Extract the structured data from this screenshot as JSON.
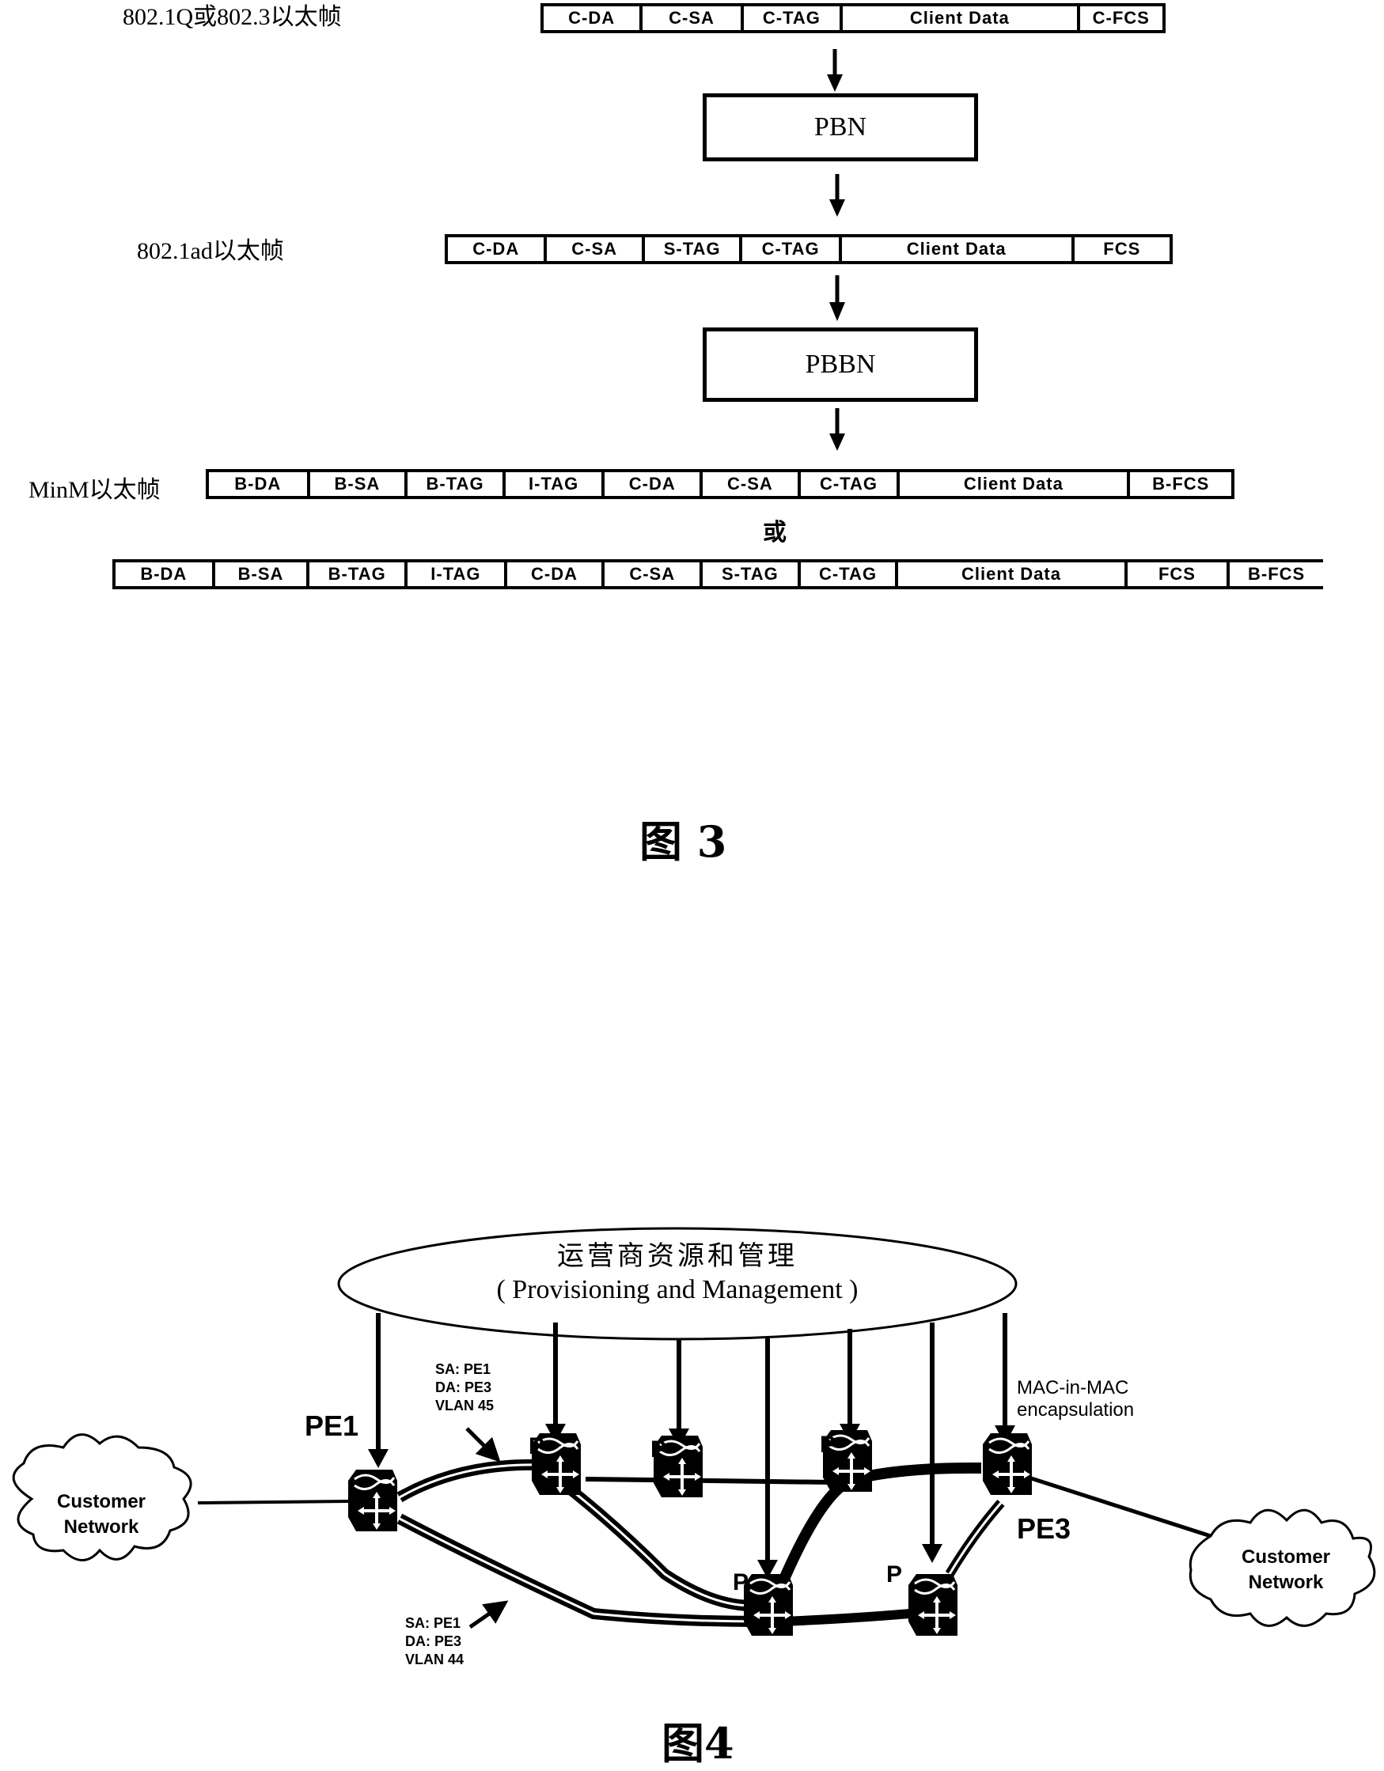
{
  "figure3": {
    "caption": "图 3",
    "frames": [
      {
        "label": "802.1Q或802.3以太帧",
        "fields": [
          "C-DA",
          "C-SA",
          "C-TAG",
          "Client Data",
          "C-FCS"
        ]
      },
      {
        "label": "802.1ad以太帧",
        "fields": [
          "C-DA",
          "C-SA",
          "S-TAG",
          "C-TAG",
          "Client Data",
          "FCS"
        ]
      },
      {
        "label": "MinM以太帧",
        "fields": [
          "B-DA",
          "B-SA",
          "B-TAG",
          "I-TAG",
          "C-DA",
          "C-SA",
          "C-TAG",
          "Client Data",
          "B-FCS"
        ]
      },
      {
        "label": "",
        "fields": [
          "B-DA",
          "B-SA",
          "B-TAG",
          "I-TAG",
          "C-DA",
          "C-SA",
          "S-TAG",
          "C-TAG",
          "Client Data",
          "FCS",
          "B-FCS"
        ]
      }
    ],
    "process_boxes": [
      "PBN",
      "PBBN"
    ],
    "or_label": "或"
  },
  "figure4": {
    "caption": "图4",
    "management": {
      "title_cn": "运营商资源和管理",
      "title_en": "( Provisioning and Management )"
    },
    "clouds": [
      {
        "line1": "Customer",
        "line2": "Network"
      },
      {
        "line1": "Customer",
        "line2": "Network"
      }
    ],
    "nodes": {
      "pe1": "PE1",
      "pe3": "PE3",
      "p": "P"
    },
    "annotations": {
      "upper_path": [
        "SA: PE1",
        "DA: PE3",
        "VLAN 45"
      ],
      "lower_path": [
        "SA: PE1",
        "DA: PE3",
        "VLAN 44"
      ],
      "encapsulation": [
        "MAC-in-MAC",
        "encapsulation"
      ]
    }
  }
}
